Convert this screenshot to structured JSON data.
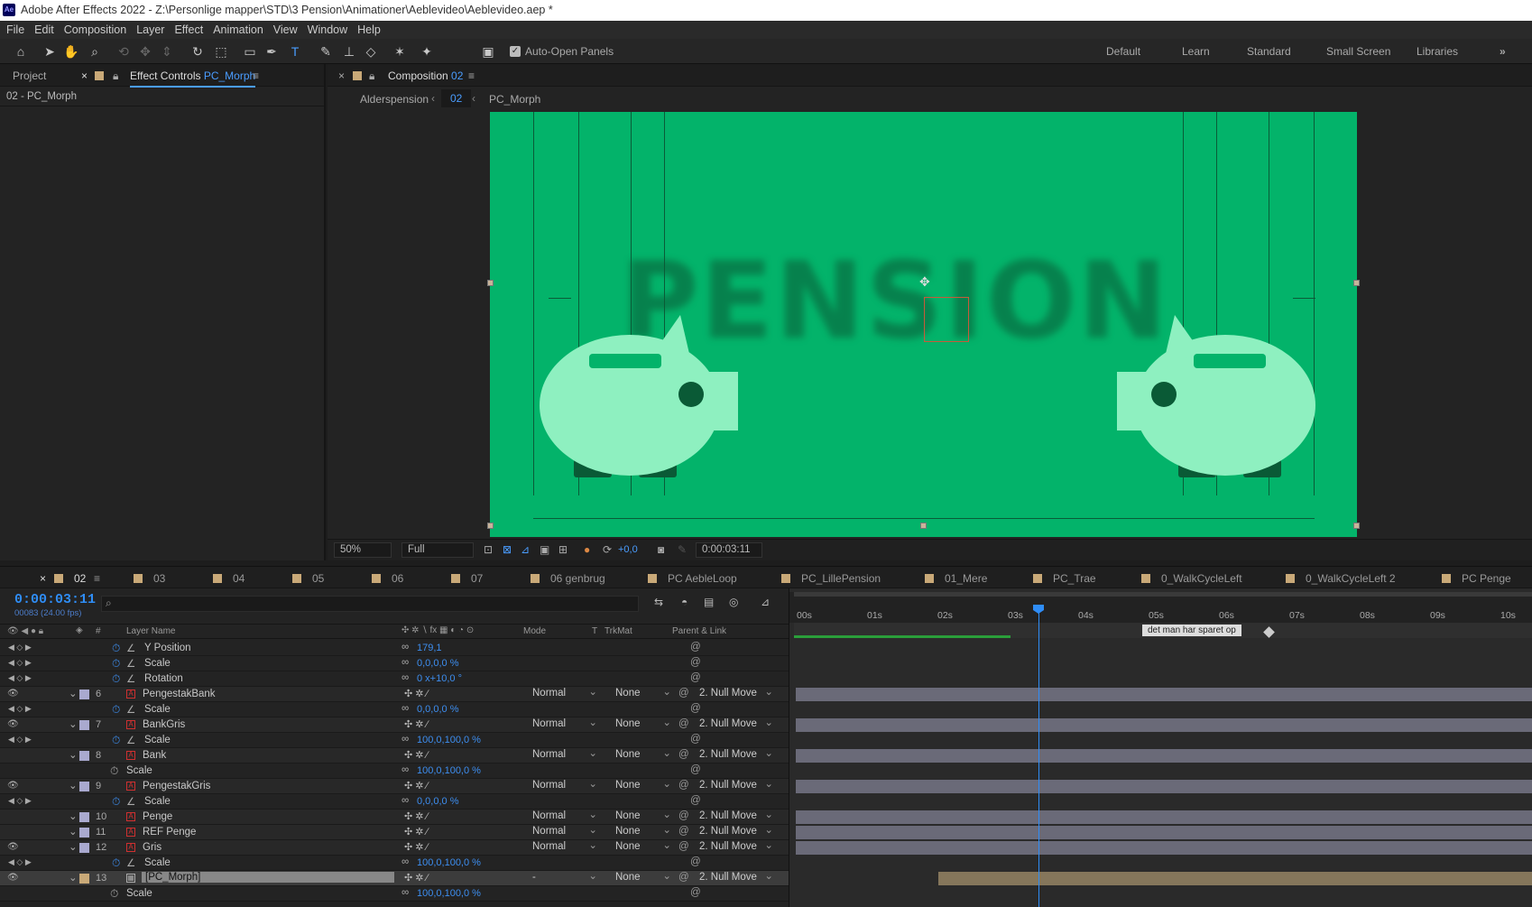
{
  "app": {
    "title": "Adobe After Effects 2022 - Z:\\Personlige mapper\\STD\\3 Pension\\Animationer\\Aeblevideo\\Aeblevideo.aep *",
    "logo": "Ae"
  },
  "menu": [
    "File",
    "Edit",
    "Composition",
    "Layer",
    "Effect",
    "Animation",
    "View",
    "Window",
    "Help"
  ],
  "toolbar": {
    "auto_open": "Auto-Open Panels",
    "workspaces": [
      "Default",
      "Learn",
      "Standard",
      "Small Screen",
      "Libraries"
    ],
    "more": "»"
  },
  "left_panel": {
    "tab_project": "Project",
    "tab_effect": "Effect Controls",
    "tab_effect_target": "PC_Morph",
    "breadcrumb": "02 - PC_Morph"
  },
  "comp_panel": {
    "tab_label": "Composition",
    "tab_target": "02",
    "crumbs": [
      "Alderspension",
      "02",
      "PC_Morph"
    ],
    "canvas_text": "PENSION",
    "zoom": "50%",
    "resolution": "Full",
    "exposure": "+0,0",
    "timecode": "0:00:03:11",
    "bg_color": "#03b36a",
    "pig_color": "#8ef0c0"
  },
  "timeline": {
    "tabs": [
      "02",
      "03",
      "04",
      "05",
      "06",
      "07",
      "06 genbrug",
      "PC AebleLoop",
      "PC_LillePension",
      "01_Mere",
      "PC_Trae",
      "0_WalkCycleLeft",
      "0_WalkCycleLeft 2",
      "PC Penge"
    ],
    "timecode": "0:00:03:11",
    "fps": "00083 (24.00 fps)",
    "search_placeholder": "",
    "columns": {
      "layer_name": "Layer Name",
      "mode": "Mode",
      "t": "T",
      "trkmat": "TrkMat",
      "parent": "Parent & Link"
    },
    "ruler": [
      "00s",
      "01s",
      "02s",
      "03s",
      "04s",
      "05s",
      "06s",
      "07s",
      "08s",
      "09s",
      "10s"
    ],
    "marker_label": "det man har sparet op",
    "rows": [
      {
        "kind": "prop",
        "name": "Y Position",
        "value": "179,1"
      },
      {
        "kind": "prop",
        "name": "Scale",
        "value": "0,0,0,0 %"
      },
      {
        "kind": "prop",
        "name": "Rotation",
        "value": "0 x+10,0 °"
      },
      {
        "kind": "layer",
        "idx": "6",
        "name": "PengestakBank",
        "mode": "Normal",
        "trk": "None",
        "parent": "2. Null Move"
      },
      {
        "kind": "prop",
        "name": "Scale",
        "value": "0,0,0,0 %"
      },
      {
        "kind": "layer",
        "idx": "7",
        "name": "BankGris",
        "mode": "Normal",
        "trk": "None",
        "parent": "2. Null Move"
      },
      {
        "kind": "prop",
        "name": "Scale",
        "value": "100,0,100,0 %"
      },
      {
        "kind": "layer",
        "idx": "8",
        "name": "Bank",
        "mode": "Normal",
        "trk": "None",
        "parent": "2. Null Move"
      },
      {
        "kind": "prop2",
        "name": "Scale",
        "value": "100,0,100,0 %"
      },
      {
        "kind": "layer",
        "idx": "9",
        "name": "PengestakGris",
        "mode": "Normal",
        "trk": "None",
        "parent": "2. Null Move"
      },
      {
        "kind": "prop",
        "name": "Scale",
        "value": "0,0,0,0 %"
      },
      {
        "kind": "layer",
        "idx": "10",
        "name": "Penge",
        "mode": "Normal",
        "trk": "None",
        "parent": "2. Null Move"
      },
      {
        "kind": "layer",
        "idx": "11",
        "name": "REF Penge",
        "mode": "Normal",
        "trk": "None",
        "parent": "2. Null Move"
      },
      {
        "kind": "layer",
        "idx": "12",
        "name": "Gris",
        "mode": "Normal",
        "trk": "None",
        "parent": "2. Null Move"
      },
      {
        "kind": "prop",
        "name": "Scale",
        "value": "100,0,100,0 %"
      },
      {
        "kind": "sel",
        "idx": "13",
        "name": "[PC_Morph]",
        "mode": "-",
        "trk": "None",
        "parent": "2. Null Move"
      },
      {
        "kind": "prop2",
        "name": "Scale",
        "value": "100,0,100,0 %"
      }
    ]
  }
}
